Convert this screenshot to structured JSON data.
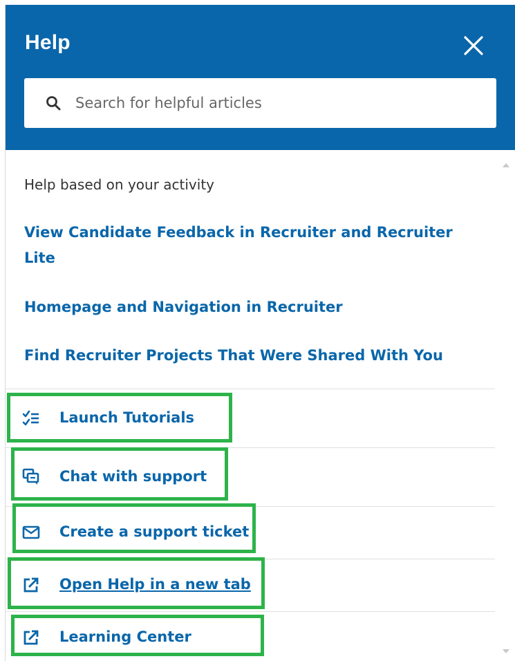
{
  "header": {
    "title": "Help",
    "close_icon": "close-icon",
    "background": "#0A66AA"
  },
  "search": {
    "placeholder": "Search for helpful articles",
    "value": "",
    "icon": "search-icon"
  },
  "activity": {
    "heading": "Help based on your activity",
    "articles": [
      {
        "label": "View Candidate Feedback in Recruiter and Recruiter Lite"
      },
      {
        "label": "Homepage and Navigation in Recruiter"
      },
      {
        "label": "Find Recruiter Projects That Were Shared With You"
      }
    ]
  },
  "actions": [
    {
      "label": "Launch Tutorials",
      "icon": "checklist-icon"
    },
    {
      "label": "Chat with support",
      "icon": "chat-icon"
    },
    {
      "label": "Create a support ticket",
      "icon": "envelope-icon"
    },
    {
      "label": "Open Help in a new tab",
      "icon": "external-link-icon"
    },
    {
      "label": "Learning Center",
      "icon": "external-link-icon"
    }
  ],
  "colors": {
    "accent": "#0A66AA",
    "highlight": "#2DB34A"
  }
}
